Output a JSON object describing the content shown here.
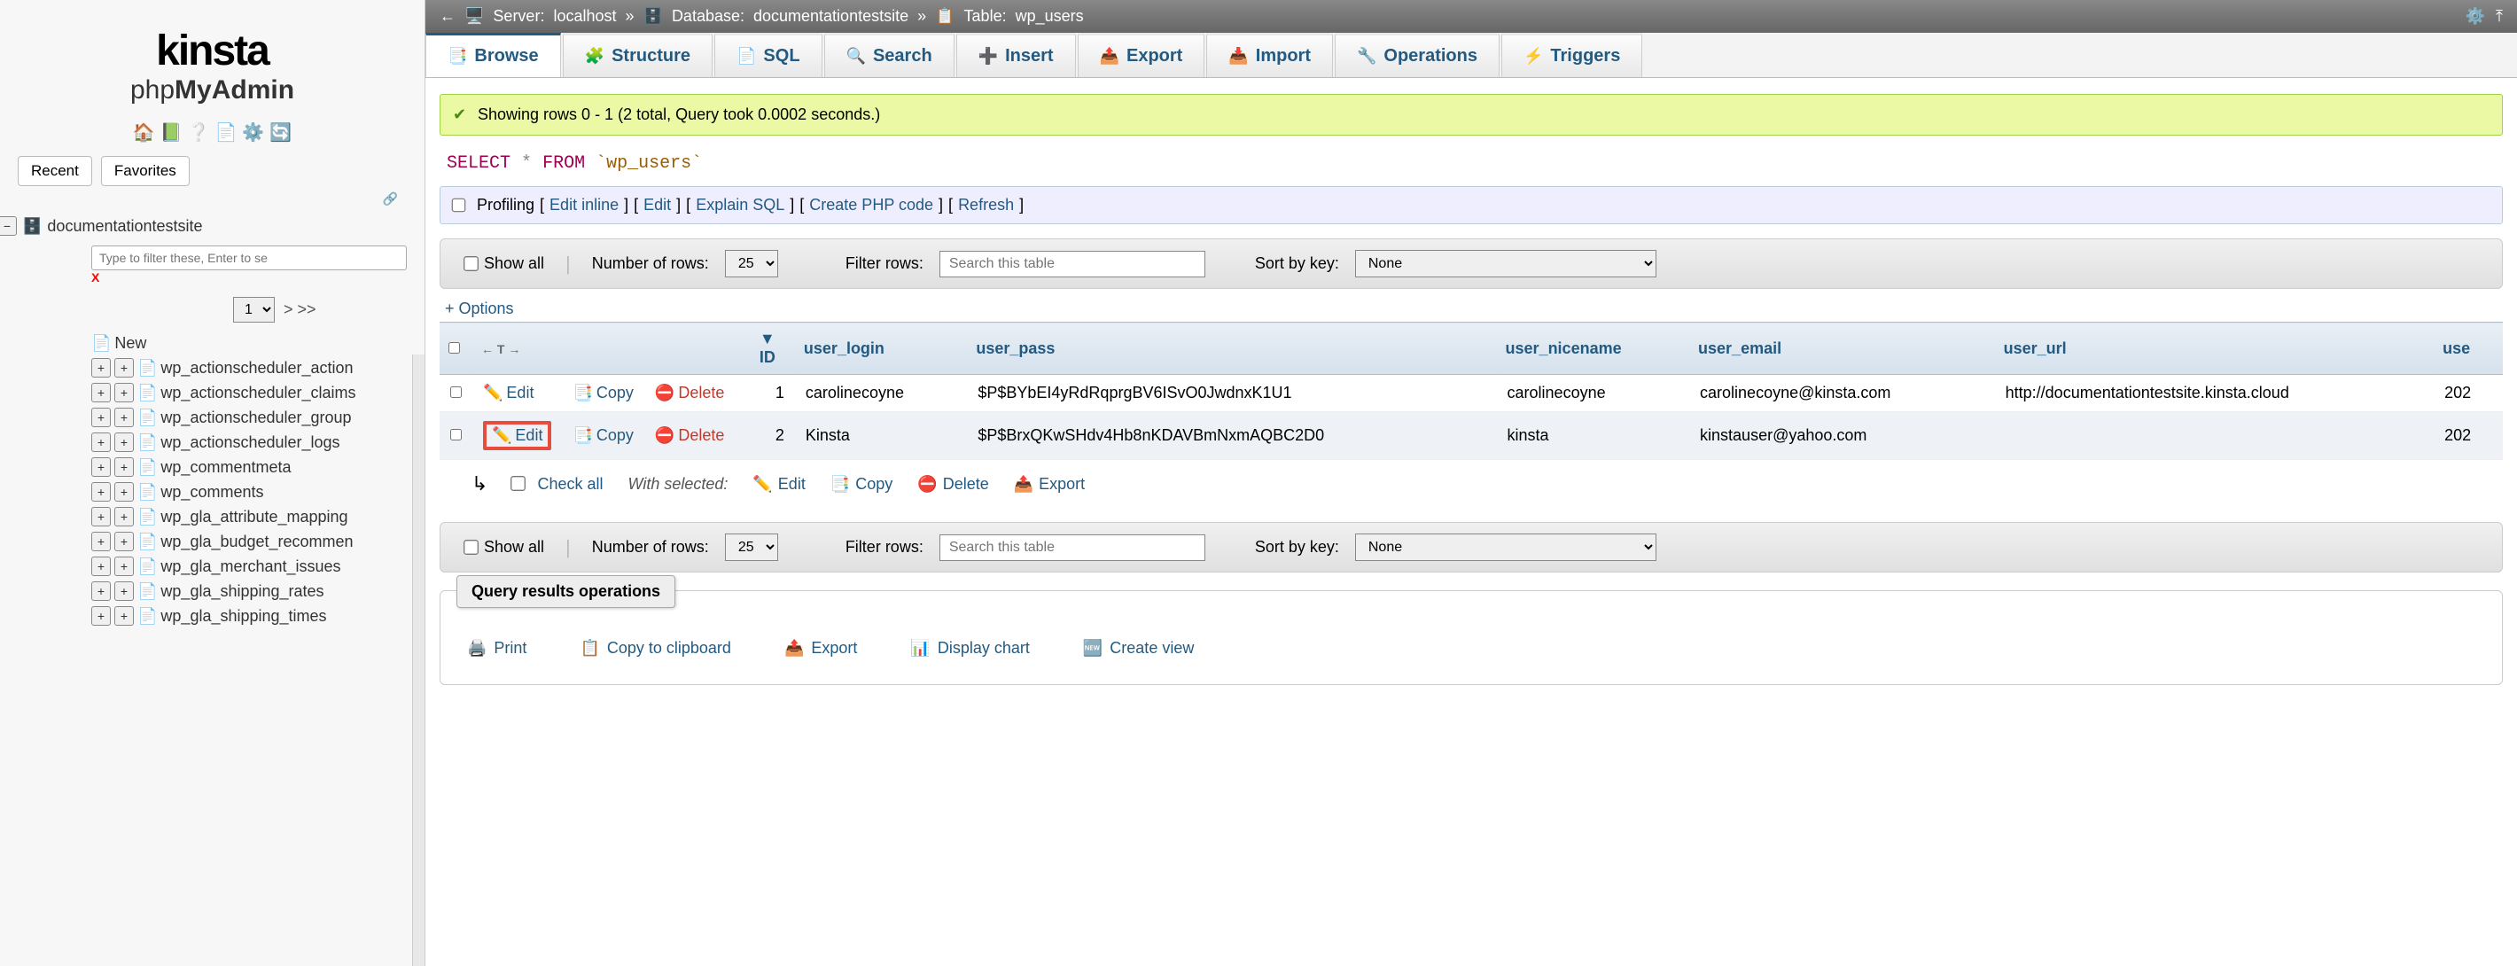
{
  "logo": {
    "brand": "kinsta",
    "php": "php",
    "myadmin": "MyAdmin"
  },
  "sidebar_tabs": {
    "recent": "Recent",
    "favorites": "Favorites"
  },
  "db_name": "documentationtestsite",
  "filter_placeholder": "Type to filter these, Enter to se",
  "page_selected": "1",
  "page_arrows": "> >>",
  "new_label": "New",
  "tables": [
    "wp_actionscheduler_action",
    "wp_actionscheduler_claims",
    "wp_actionscheduler_group",
    "wp_actionscheduler_logs",
    "wp_commentmeta",
    "wp_comments",
    "wp_gla_attribute_mapping",
    "wp_gla_budget_recommen",
    "wp_gla_merchant_issues",
    "wp_gla_shipping_rates",
    "wp_gla_shipping_times"
  ],
  "breadcrumb": {
    "server_label": "Server:",
    "server_value": "localhost",
    "db_label": "Database:",
    "db_value": "documentationtestsite",
    "table_label": "Table:",
    "table_value": "wp_users"
  },
  "tabs": [
    {
      "icon": "📑",
      "label": "Browse"
    },
    {
      "icon": "🧩",
      "label": "Structure"
    },
    {
      "icon": "📄",
      "label": "SQL"
    },
    {
      "icon": "🔍",
      "label": "Search"
    },
    {
      "icon": "➕",
      "label": "Insert"
    },
    {
      "icon": "📤",
      "label": "Export"
    },
    {
      "icon": "📥",
      "label": "Import"
    },
    {
      "icon": "🔧",
      "label": "Operations"
    },
    {
      "icon": "⚡",
      "label": "Triggers"
    }
  ],
  "success_msg": "Showing rows 0 - 1 (2 total, Query took 0.0002 seconds.)",
  "sql": {
    "select": "SELECT",
    "star": "*",
    "from": "FROM",
    "table": "`wp_users`"
  },
  "profiling": {
    "label": "Profiling",
    "links": [
      "Edit inline",
      "Edit",
      "Explain SQL",
      "Create PHP code",
      "Refresh"
    ]
  },
  "controls": {
    "show_all": "Show all",
    "num_rows": "Number of rows:",
    "num_rows_value": "25",
    "filter_label": "Filter rows:",
    "filter_placeholder": "Search this table",
    "sort_label": "Sort by key:",
    "sort_value": "None"
  },
  "options_link": "+ Options",
  "columns": [
    "ID",
    "user_login",
    "user_pass",
    "user_nicename",
    "user_email",
    "user_url",
    "use"
  ],
  "row_actions": {
    "edit": "Edit",
    "copy": "Copy",
    "delete": "Delete"
  },
  "rows": [
    {
      "id": "1",
      "login": "carolinecoyne",
      "pass": "$P$BYbEI4yRdRqprgBV6ISvO0JwdnxK1U1",
      "nice": "carolinecoyne",
      "email": "carolinecoyne@kinsta.com",
      "url": "http://documentationtestsite.kinsta.cloud",
      "tail": "202"
    },
    {
      "id": "2",
      "login": "Kinsta",
      "pass": "$P$BrxQKwSHdv4Hb8nKDAVBmNxmAQBC2D0",
      "nice": "kinsta",
      "email": "kinstauser@yahoo.com",
      "url": "",
      "tail": "202"
    }
  ],
  "bulk": {
    "check_all": "Check all",
    "with_selected": "With selected:",
    "edit": "Edit",
    "copy": "Copy",
    "delete": "Delete",
    "export": "Export"
  },
  "qro": {
    "title": "Query results operations",
    "print": "Print",
    "clipboard": "Copy to clipboard",
    "export": "Export",
    "chart": "Display chart",
    "view": "Create view"
  }
}
